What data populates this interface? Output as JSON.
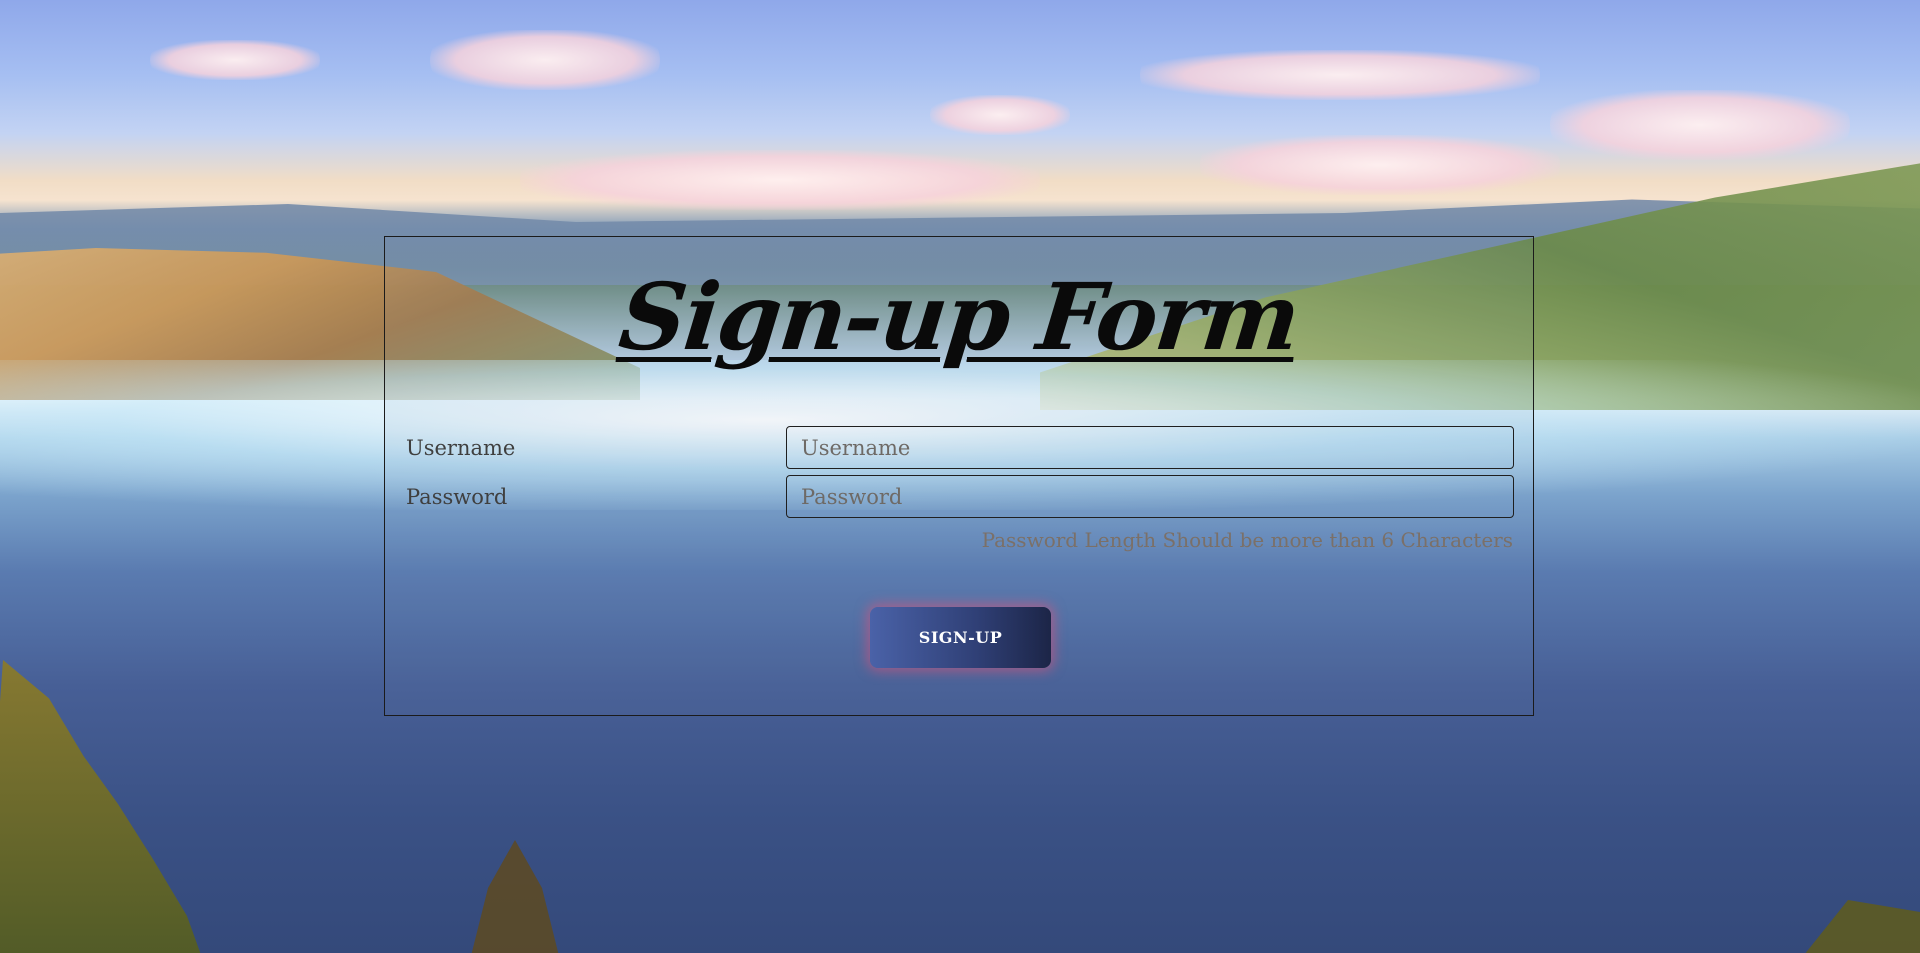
{
  "form": {
    "title": "Sign-up Form",
    "username": {
      "label": "Username",
      "placeholder": "Username",
      "value": ""
    },
    "password": {
      "label": "Password",
      "placeholder": "Password",
      "value": ""
    },
    "hint": "Password Length Should be more than 6 Characters",
    "submit_label": "SIGN-UP"
  },
  "colors": {
    "panel_border": "#1b1b1b",
    "button_start": "#4a62a8",
    "button_end": "#1c2547",
    "button_glow": "#e65078",
    "hint_text": "#7b7068"
  }
}
